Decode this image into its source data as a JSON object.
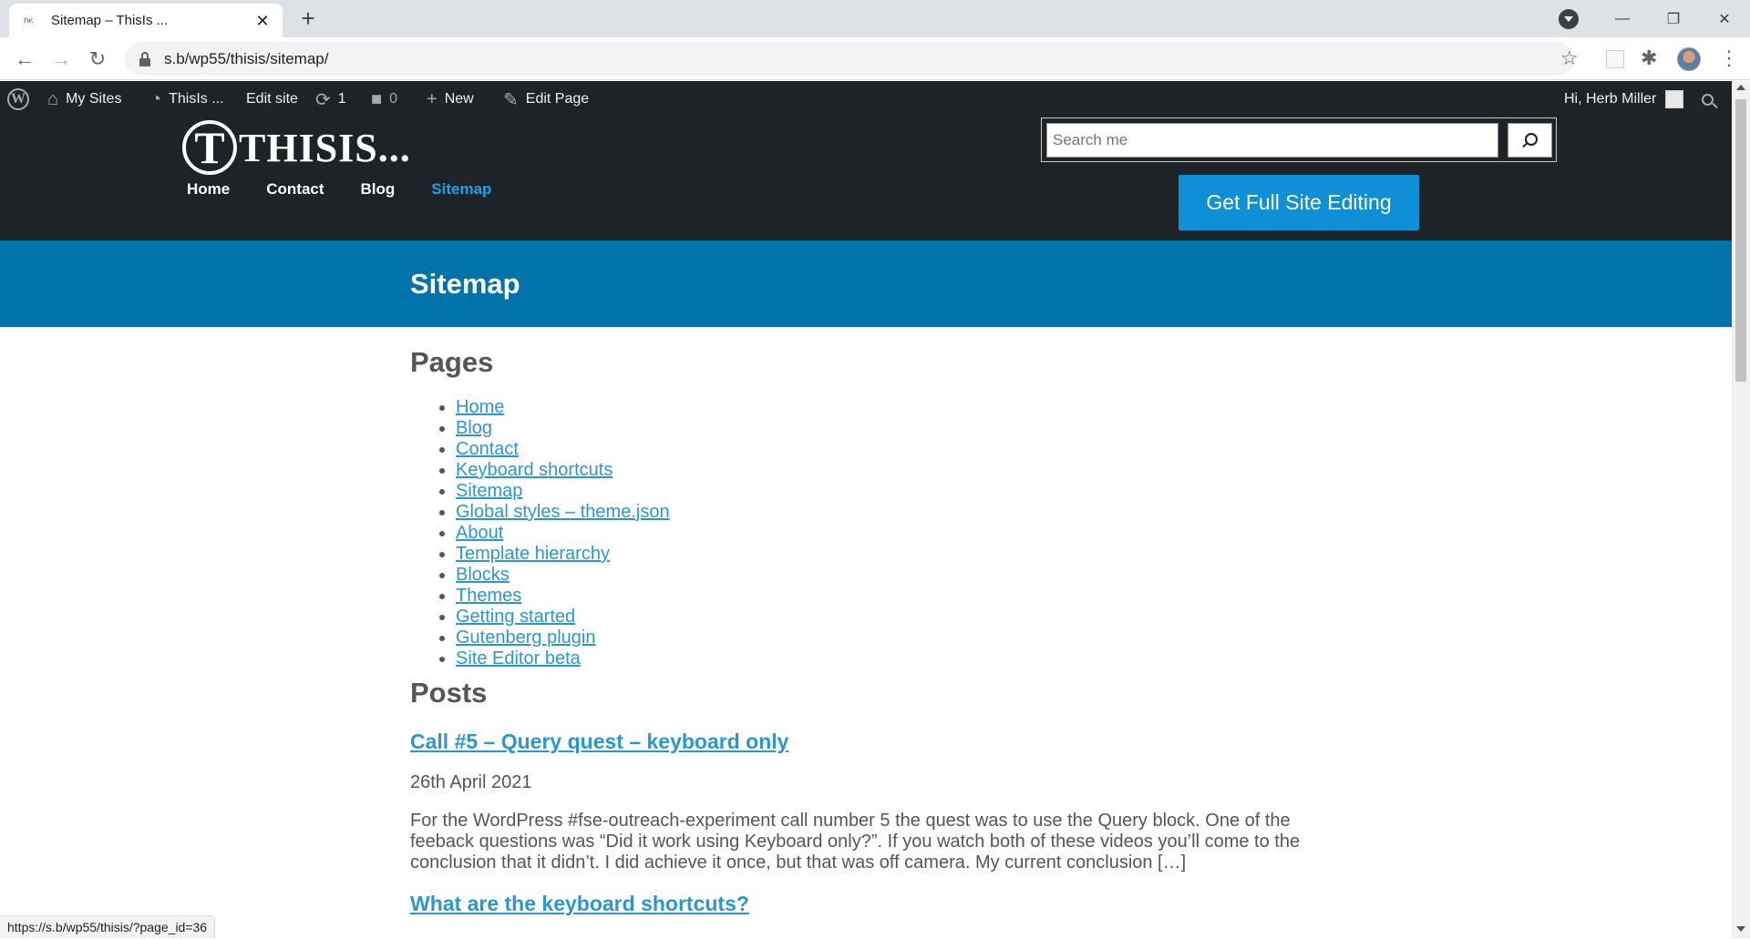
{
  "browser": {
    "tab_title": "Sitemap – ThisIs ...",
    "tab_favicon_text": "tw.",
    "tab_close": "✕",
    "new_tab": "+",
    "url": "s.b/wp55/thisis/sitemap/",
    "status_url": "https://s.b/wp55/thisis/?page_id=36",
    "window_controls": [
      "—",
      "❐",
      "✕"
    ]
  },
  "adminbar": {
    "my_sites": "My Sites",
    "site_name": "ThisIs ...",
    "edit_site": "Edit site",
    "updates_count": "1",
    "comments_count": "0",
    "new": "New",
    "edit_page": "Edit Page",
    "greeting": "Hi, Herb Miller"
  },
  "header": {
    "logo_letter": "T",
    "logo_text": "THISIS...",
    "nav": [
      "Home",
      "Contact",
      "Blog",
      "Sitemap"
    ],
    "search_placeholder": "Search me",
    "cta_label": "Get Full Site Editing"
  },
  "page": {
    "title": "Sitemap",
    "pages_heading": "Pages",
    "pages": [
      "Home",
      "Blog",
      "Contact",
      "Keyboard shortcuts",
      "Sitemap",
      "Global styles – theme.json",
      "About",
      "Template hierarchy",
      "Blocks",
      "Themes",
      "Getting started",
      "Gutenberg plugin",
      "Site Editor beta"
    ],
    "posts_heading": "Posts",
    "posts": [
      {
        "title": "Call #5 – Query quest – keyboard only",
        "date": "26th April 2021",
        "excerpt": "For the WordPress #fse-outreach-experiment call number 5 the quest was to use the Query block. One of the feeback questions was “Did it work using Keyboard only?”. If you watch both of these videos you’ll come to the conclusion that it didn’t. I did achieve it once, but that was off camera. My current conclusion […]"
      },
      {
        "title": "What are the keyboard shortcuts?"
      }
    ]
  },
  "colors": {
    "admin_bg": "#1d2327",
    "accent_blue": "#0073aa",
    "link_blue": "#2997d6",
    "cta_blue": "#0e8fd6"
  }
}
